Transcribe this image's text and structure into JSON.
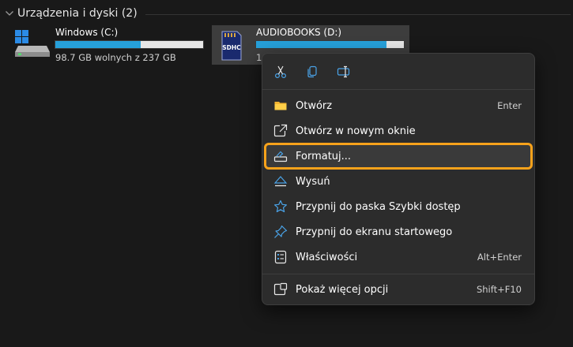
{
  "group": {
    "title": "Urządzenia i dyski (2)"
  },
  "drives": [
    {
      "name": "Windows (C:)",
      "free_text": "98.7 GB wolnych z 237 GB",
      "used_fraction": 0.58,
      "icon": "windows-drive-icon"
    },
    {
      "name": "AUDIOBOOKS (D:)",
      "free_text": "1",
      "used_fraction": 0.88,
      "icon": "sd-card-icon",
      "card_label": "SDHC"
    }
  ],
  "quick_actions": [
    {
      "name": "cut",
      "icon": "scissors-icon"
    },
    {
      "name": "copy",
      "icon": "copy-icon"
    },
    {
      "name": "rename",
      "icon": "rename-icon"
    }
  ],
  "menu": {
    "items": [
      {
        "label": "Otwórz",
        "shortcut": "Enter",
        "icon": "folder-icon"
      },
      {
        "label": "Otwórz w nowym oknie",
        "shortcut": "",
        "icon": "open-new-window-icon"
      },
      {
        "label": "Formatuj...",
        "shortcut": "",
        "icon": "format-drive-icon",
        "highlighted": true
      },
      {
        "label": "Wysuń",
        "shortcut": "",
        "icon": "eject-icon"
      },
      {
        "label": "Przypnij do paska Szybki dostęp",
        "shortcut": "",
        "icon": "star-icon"
      },
      {
        "label": "Przypnij do ekranu startowego",
        "shortcut": "",
        "icon": "pin-icon"
      },
      {
        "label": "Właściwości",
        "shortcut": "Alt+Enter",
        "icon": "properties-icon"
      }
    ],
    "more": {
      "label": "Pokaż więcej opcji",
      "shortcut": "Shift+F10",
      "icon": "more-options-icon"
    }
  },
  "colors": {
    "background": "#191919",
    "menu": "#2c2c2c",
    "highlight_border": "#f7a21b",
    "bar_fill": "#26a0da",
    "accent_icon": "#4aa3e8"
  }
}
